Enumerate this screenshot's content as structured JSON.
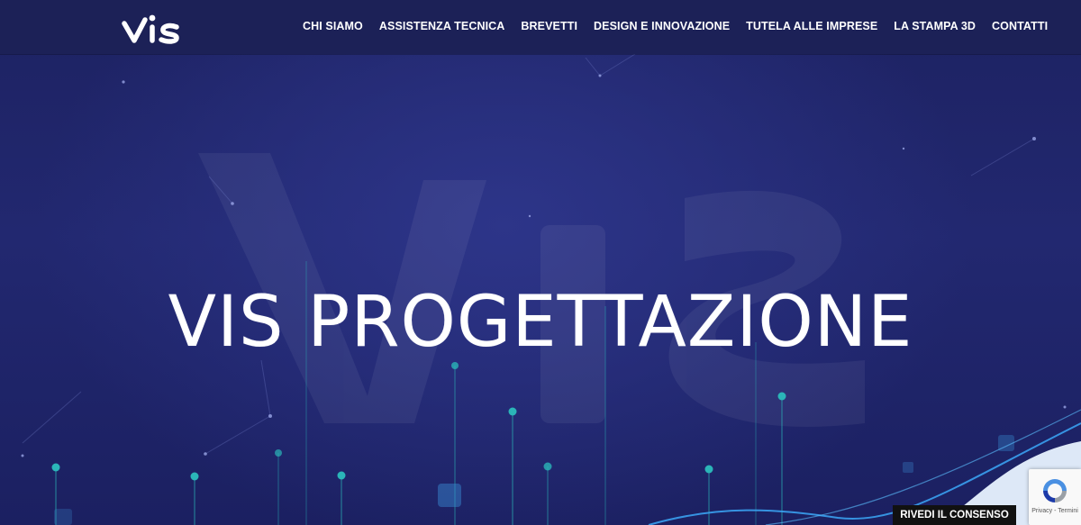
{
  "header": {
    "logo_text": "VIS",
    "nav": [
      {
        "label": "CHI SIAMO"
      },
      {
        "label": "ASSISTENZA TECNICA"
      },
      {
        "label": "BREVETTI"
      },
      {
        "label": "DESIGN E INNOVAZIONE"
      },
      {
        "label": "TUTELA ALLE IMPRESE"
      },
      {
        "label": "LA STAMPA 3D"
      },
      {
        "label": "CONTATTI"
      }
    ]
  },
  "hero": {
    "title": "VIS PROGETTAZIONE",
    "background_watermark": "VIS"
  },
  "consent": {
    "button_label": "RIVEDI IL CONSENSO"
  },
  "recaptcha": {
    "privacy": "Privacy",
    "separator": " - ",
    "terms": "Termini"
  },
  "colors": {
    "topbar": "#1c2157",
    "hero_bg": "#222870",
    "accent_teal": "#2bb5b8",
    "accent_blue": "#3a8fd6"
  }
}
